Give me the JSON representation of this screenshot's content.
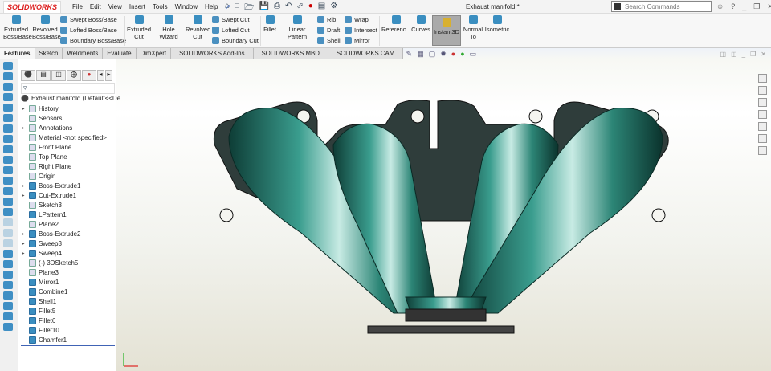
{
  "app": {
    "logo": "SOLIDWORKS",
    "document_title": "Exhaust manifold *",
    "search_placeholder": "Search Commands"
  },
  "menu": [
    "File",
    "Edit",
    "View",
    "Insert",
    "Tools",
    "Window",
    "Help"
  ],
  "ribbon": {
    "extruded_boss": "Extruded Boss/Base",
    "revolved_boss": "Revolved Boss/Base",
    "swept_boss": "Swept Boss/Base",
    "lofted_boss": "Lofted Boss/Base",
    "boundary_boss": "Boundary Boss/Base",
    "extruded_cut": "Extruded Cut",
    "hole_wizard": "Hole Wizard",
    "revolved_cut": "Revolved Cut",
    "swept_cut": "Swept Cut",
    "lofted_cut": "Lofted Cut",
    "boundary_cut": "Boundary Cut",
    "fillet": "Fillet",
    "linear_pattern": "Linear Pattern",
    "rib": "Rib",
    "draft": "Draft",
    "shell": "Shell",
    "wrap": "Wrap",
    "intersect": "Intersect",
    "mirror": "Mirror",
    "reference": "Referenc...",
    "curves": "Curves",
    "instant3d": "Instant3D",
    "normal_to": "Normal To",
    "isometric": "Isometric"
  },
  "tabs": [
    "Features",
    "Sketch",
    "Weldments",
    "Evaluate",
    "DimXpert",
    "SOLIDWORKS Add-Ins",
    "SOLIDWORKS MBD",
    "SOLIDWORKS CAM"
  ],
  "tree": {
    "root": "Exhaust manifold  (Default<<De",
    "items": [
      {
        "label": "History",
        "exp": true
      },
      {
        "label": "Sensors",
        "exp": false
      },
      {
        "label": "Annotations",
        "exp": true
      },
      {
        "label": "Material <not specified>",
        "exp": false
      },
      {
        "label": "Front Plane",
        "exp": false
      },
      {
        "label": "Top Plane",
        "exp": false
      },
      {
        "label": "Right Plane",
        "exp": false
      },
      {
        "label": "Origin",
        "exp": false
      },
      {
        "label": "Boss-Extrude1",
        "exp": true
      },
      {
        "label": "Cut-Extrude1",
        "exp": true
      },
      {
        "label": "Sketch3",
        "exp": false
      },
      {
        "label": "LPattern1",
        "exp": false
      },
      {
        "label": "Plane2",
        "exp": false
      },
      {
        "label": "Boss-Extrude2",
        "exp": true
      },
      {
        "label": "Sweep3",
        "exp": true
      },
      {
        "label": "Sweep4",
        "exp": true
      },
      {
        "label": "(-) 3DSketch5",
        "exp": false
      },
      {
        "label": "Plane3",
        "exp": false
      },
      {
        "label": "Mirror1",
        "exp": false
      },
      {
        "label": "Combine1",
        "exp": false
      },
      {
        "label": "Shell1",
        "exp": false
      },
      {
        "label": "Fillet5",
        "exp": false
      },
      {
        "label": "Fillet6",
        "exp": false
      },
      {
        "label": "Fillet10",
        "exp": false
      },
      {
        "label": "Chamfer1",
        "exp": false
      }
    ]
  },
  "colors": {
    "model": "#1f6f63",
    "flange": "#2a3a38",
    "accent": "#3a8ec0"
  }
}
